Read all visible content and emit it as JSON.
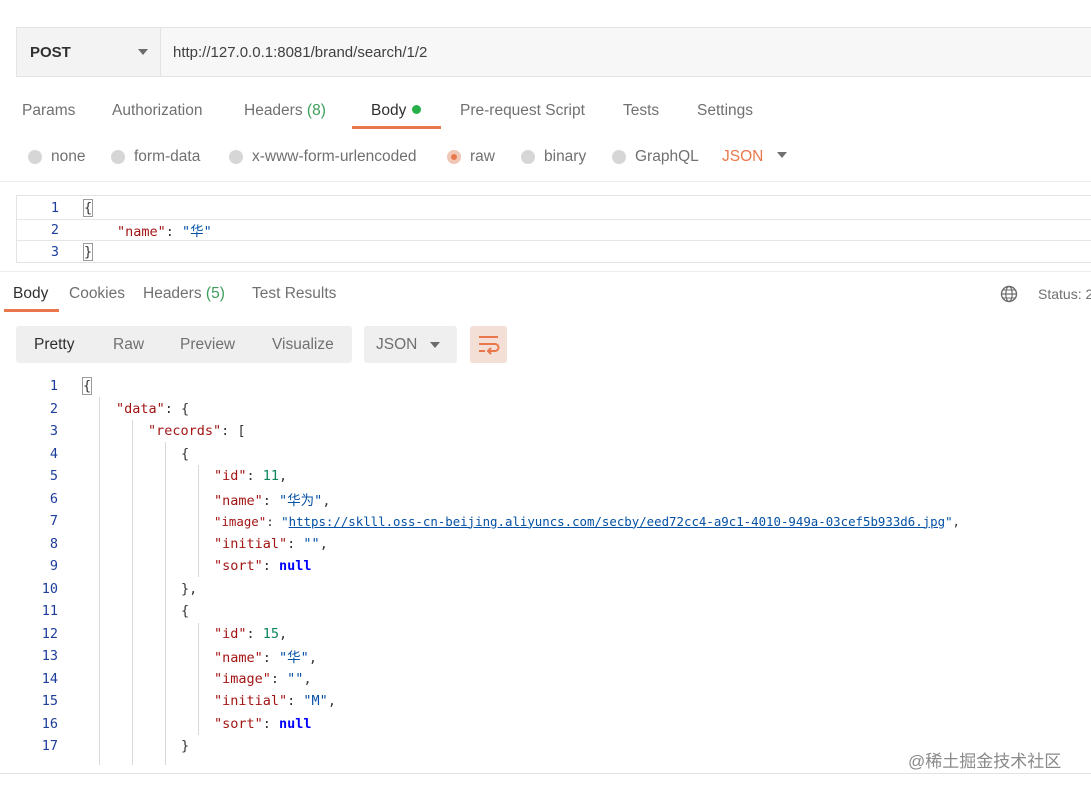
{
  "request": {
    "method": "POST",
    "url": "http://127.0.0.1:8081/brand/search/1/2"
  },
  "request_tabs": {
    "params": "Params",
    "authorization": "Authorization",
    "headers": "Headers",
    "headers_count": "(8)",
    "body": "Body",
    "prerequest": "Pre-request Script",
    "tests": "Tests",
    "settings": "Settings"
  },
  "body_types": {
    "none": "none",
    "form_data": "form-data",
    "urlencoded": "x-www-form-urlencoded",
    "raw": "raw",
    "binary": "binary",
    "graphql": "GraphQL",
    "format": "JSON",
    "selected": "raw"
  },
  "request_body": {
    "line_numbers": [
      "1",
      "2",
      "3"
    ],
    "l1": "{",
    "l2_key": "\"name\"",
    "l2_sep": ": ",
    "l2_val": "\"华\"",
    "l3": "}"
  },
  "response_tabs": {
    "body": "Body",
    "cookies": "Cookies",
    "headers": "Headers",
    "headers_count": "(5)",
    "test_results": "Test Results",
    "status_label": "Status: 2"
  },
  "response_toolbar": {
    "pretty": "Pretty",
    "raw": "Raw",
    "preview": "Preview",
    "visualize": "Visualize",
    "format": "JSON"
  },
  "response_body": {
    "line_numbers": [
      "1",
      "2",
      "3",
      "4",
      "5",
      "6",
      "7",
      "8",
      "9",
      "10",
      "11",
      "12",
      "13",
      "14",
      "15",
      "16",
      "17"
    ],
    "l1": "{",
    "l2_key": "\"data\"",
    "l2_rest": ": {",
    "l3_key": "\"records\"",
    "l3_rest": ": [",
    "l4": "{",
    "l5_key": "\"id\"",
    "l5_val": "11",
    "l6_key": "\"name\"",
    "l6_val": "\"华为\"",
    "l7_key": "\"image\"",
    "l7_q": "\"",
    "l7_url": "https://sklll.oss-cn-beijing.aliyuncs.com/secby/eed72cc4-a9c1-4010-949a-03cef5b933d6.jpg",
    "l8_key": "\"initial\"",
    "l8_val": "\"\"",
    "l9_key": "\"sort\"",
    "l9_val": "null",
    "l10": "},",
    "l11": "{",
    "l12_key": "\"id\"",
    "l12_val": "15",
    "l13_key": "\"name\"",
    "l13_val": "\"华\"",
    "l14_key": "\"image\"",
    "l14_val": "\"\"",
    "l15_key": "\"initial\"",
    "l15_val": "\"M\"",
    "l16_key": "\"sort\"",
    "l16_val": "null",
    "l17": "}"
  },
  "watermark": "@稀土掘金技术社区",
  "colors": {
    "accent": "#e9774b",
    "active_dot": "#26b047",
    "json_key": "#a31515",
    "json_string": "#0451a5",
    "json_number": "#098658"
  }
}
